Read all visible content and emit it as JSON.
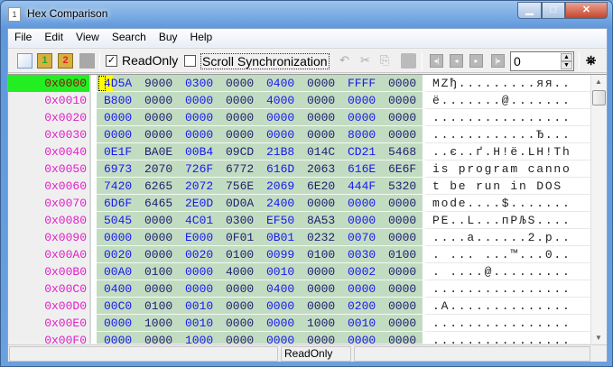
{
  "window": {
    "title": "Hex Comparison",
    "app_icon_label": "1"
  },
  "menu": [
    "File",
    "Edit",
    "View",
    "Search",
    "Buy",
    "Help"
  ],
  "toolbar": {
    "readonly_label": "ReadOnly",
    "readonly_checked": true,
    "scroll_sync_label": "Scroll Synchronization",
    "scroll_sync_checked": false,
    "offset_value": "0"
  },
  "rows": [
    {
      "addr": "0x0000",
      "hex": [
        "4D5A",
        "9000",
        "0300",
        "0000",
        "0400",
        "0000",
        "FFFF",
        "0000"
      ],
      "text": "MZђ.........яя.."
    },
    {
      "addr": "0x0010",
      "hex": [
        "B800",
        "0000",
        "0000",
        "0000",
        "4000",
        "0000",
        "0000",
        "0000"
      ],
      "text": "ё.......@......."
    },
    {
      "addr": "0x0020",
      "hex": [
        "0000",
        "0000",
        "0000",
        "0000",
        "0000",
        "0000",
        "0000",
        "0000"
      ],
      "text": "................"
    },
    {
      "addr": "0x0030",
      "hex": [
        "0000",
        "0000",
        "0000",
        "0000",
        "0000",
        "0000",
        "8000",
        "0000"
      ],
      "text": "............Ђ..."
    },
    {
      "addr": "0x0040",
      "hex": [
        "0E1F",
        "BA0E",
        "00B4",
        "09CD",
        "21B8",
        "014C",
        "CD21",
        "5468"
      ],
      "text": "..є..ґ.Н!ё.LН!Th"
    },
    {
      "addr": "0x0050",
      "hex": [
        "6973",
        "2070",
        "726F",
        "6772",
        "616D",
        "2063",
        "616E",
        "6E6F"
      ],
      "text": "is program canno"
    },
    {
      "addr": "0x0060",
      "hex": [
        "7420",
        "6265",
        "2072",
        "756E",
        "2069",
        "6E20",
        "444F",
        "5320"
      ],
      "text": "t be run in DOS "
    },
    {
      "addr": "0x0070",
      "hex": [
        "6D6F",
        "6465",
        "2E0D",
        "0D0A",
        "2400",
        "0000",
        "0000",
        "0000"
      ],
      "text": "mode....$......."
    },
    {
      "addr": "0x0080",
      "hex": [
        "5045",
        "0000",
        "4C01",
        "0300",
        "EF50",
        "8A53",
        "0000",
        "0000"
      ],
      "text": "PE..L...пPЉS...."
    },
    {
      "addr": "0x0090",
      "hex": [
        "0000",
        "0000",
        "E000",
        "0F01",
        "0B01",
        "0232",
        "0070",
        "0000"
      ],
      "text": "....а......2.p.."
    },
    {
      "addr": "0x00A0",
      "hex": [
        "0020",
        "0000",
        "0020",
        "0100",
        "0099",
        "0100",
        "0030",
        "0100"
      ],
      "text": ". ... ...™...0.."
    },
    {
      "addr": "0x00B0",
      "hex": [
        "00A0",
        "0100",
        "0000",
        "4000",
        "0010",
        "0000",
        "0002",
        "0000"
      ],
      "text": ". ....@........."
    },
    {
      "addr": "0x00C0",
      "hex": [
        "0400",
        "0000",
        "0000",
        "0000",
        "0400",
        "0000",
        "0000",
        "0000"
      ],
      "text": "................"
    },
    {
      "addr": "0x00D0",
      "hex": [
        "00C0",
        "0100",
        "0010",
        "0000",
        "0000",
        "0000",
        "0200",
        "0000"
      ],
      "text": ".А.............."
    },
    {
      "addr": "0x00E0",
      "hex": [
        "0000",
        "1000",
        "0010",
        "0000",
        "0000",
        "1000",
        "0010",
        "0000"
      ],
      "text": "................"
    },
    {
      "addr": "0x00F0",
      "hex": [
        "0000",
        "0000",
        "1000",
        "0000",
        "0000",
        "0000",
        "0000",
        "0000"
      ],
      "text": "................"
    }
  ],
  "status": {
    "mode": "ReadOnly"
  },
  "colors": {
    "address": "#e020c8",
    "current_address_bg": "#22ee22",
    "hex_bg": "#c2dcc2",
    "hex_blue": "#1818f0",
    "hex_navy": "#202070",
    "caret": "#ffff00"
  }
}
